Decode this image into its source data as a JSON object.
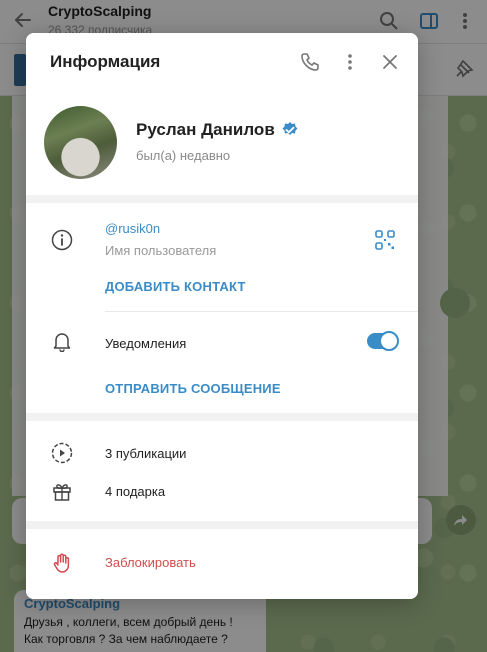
{
  "background": {
    "channel_title": "CryptoScalping",
    "channel_subtitle": "26 332 подписчика",
    "message": {
      "author": "CryptoScalping",
      "text_line1": "Друзья , коллеги, всем добрый день !",
      "text_line2": "Как торговля ? За чем наблюдаете ?"
    }
  },
  "modal": {
    "title": "Информация",
    "user": {
      "name": "Руслан Данилов",
      "status": "был(а) недавно"
    },
    "info": {
      "username": "@rusik0n",
      "username_label": "Имя пользователя",
      "add_contact": "ДОБАВИТЬ КОНТАКТ",
      "notifications_label": "Уведомления",
      "notifications_on": true,
      "send_message": "ОТПРАВИТЬ СООБЩЕНИЕ"
    },
    "stats": {
      "publications": "3 публикации",
      "gifts": "4 подарка"
    },
    "block_label": "Заблокировать"
  },
  "colors": {
    "accent": "#3a8cc7",
    "danger": "#d14c4c",
    "overlay": "rgba(0,0,0,0.45)"
  },
  "icons": [
    "back-arrow-icon",
    "search-icon",
    "sidebar-toggle-icon",
    "more-vertical-icon",
    "phone-icon",
    "close-icon",
    "verified-icon",
    "info-icon",
    "qr-code-icon",
    "bell-icon",
    "stories-icon",
    "gift-icon",
    "hand-stop-icon"
  ]
}
